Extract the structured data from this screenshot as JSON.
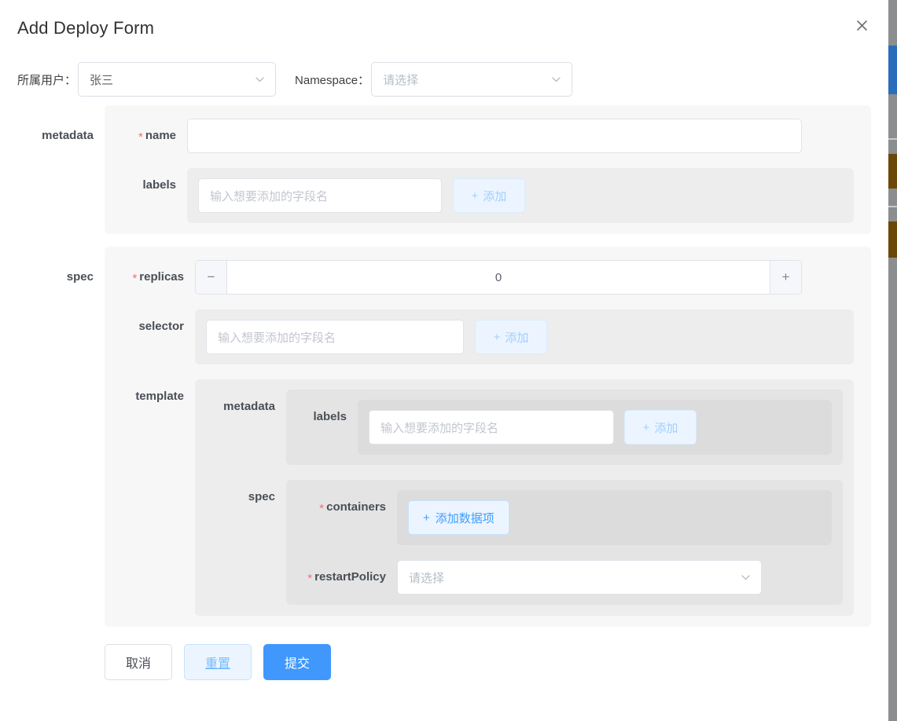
{
  "header": {
    "title": "Add Deploy Form",
    "close_icon": "close-icon"
  },
  "top_row": {
    "user": {
      "label": "所属用户：",
      "value": "张三",
      "chevron_icon": "chevron-down-icon"
    },
    "namespace": {
      "label": "Namespace：",
      "value": "",
      "placeholder": "请选择",
      "chevron_icon": "chevron-down-icon"
    }
  },
  "common": {
    "field_placeholder": "输入想要添加的字段名",
    "add_label": "添加",
    "plus_glyph": "+",
    "select_placeholder": "请选择",
    "required_mark": "*"
  },
  "metadata": {
    "section_label": "metadata",
    "name": {
      "label": "name",
      "required": true,
      "value": ""
    },
    "labels": {
      "label": "labels",
      "required": false,
      "input_value": "",
      "placeholder": "输入想要添加的字段名",
      "add_label": "添加"
    }
  },
  "spec": {
    "section_label": "spec",
    "replicas": {
      "label": "replicas",
      "required": true,
      "value": "0",
      "minus_glyph": "−",
      "plus_glyph": "+"
    },
    "selector": {
      "label": "selector",
      "required": false,
      "input_value": "",
      "placeholder": "输入想要添加的字段名",
      "add_label": "添加"
    },
    "template": {
      "label": "template",
      "metadata": {
        "label": "metadata",
        "labels": {
          "label": "labels",
          "required": false,
          "input_value": "",
          "placeholder": "输入想要添加的字段名",
          "add_label": "添加"
        }
      },
      "spec": {
        "label": "spec",
        "containers": {
          "label": "containers",
          "required": true,
          "add_item_label": "添加数据项",
          "plus_glyph": "+"
        },
        "restartPolicy": {
          "label": "restartPolicy",
          "required": true,
          "value": "",
          "placeholder": "请选择",
          "chevron_icon": "chevron-down-icon"
        }
      }
    }
  },
  "footer": {
    "cancel_label": "取消",
    "reset_label": "重置",
    "submit_label": "提交"
  },
  "colors": {
    "primary": "#4098fc",
    "required": "#f56c6c",
    "light_blue_bg": "#ecf5ff",
    "disabled_blue_text": "#a0cfff",
    "card_l1": "#f7f7f7",
    "card_l2": "#ededed",
    "card_l3": "#e4e4e4",
    "card_l4": "#dcdcdc"
  }
}
